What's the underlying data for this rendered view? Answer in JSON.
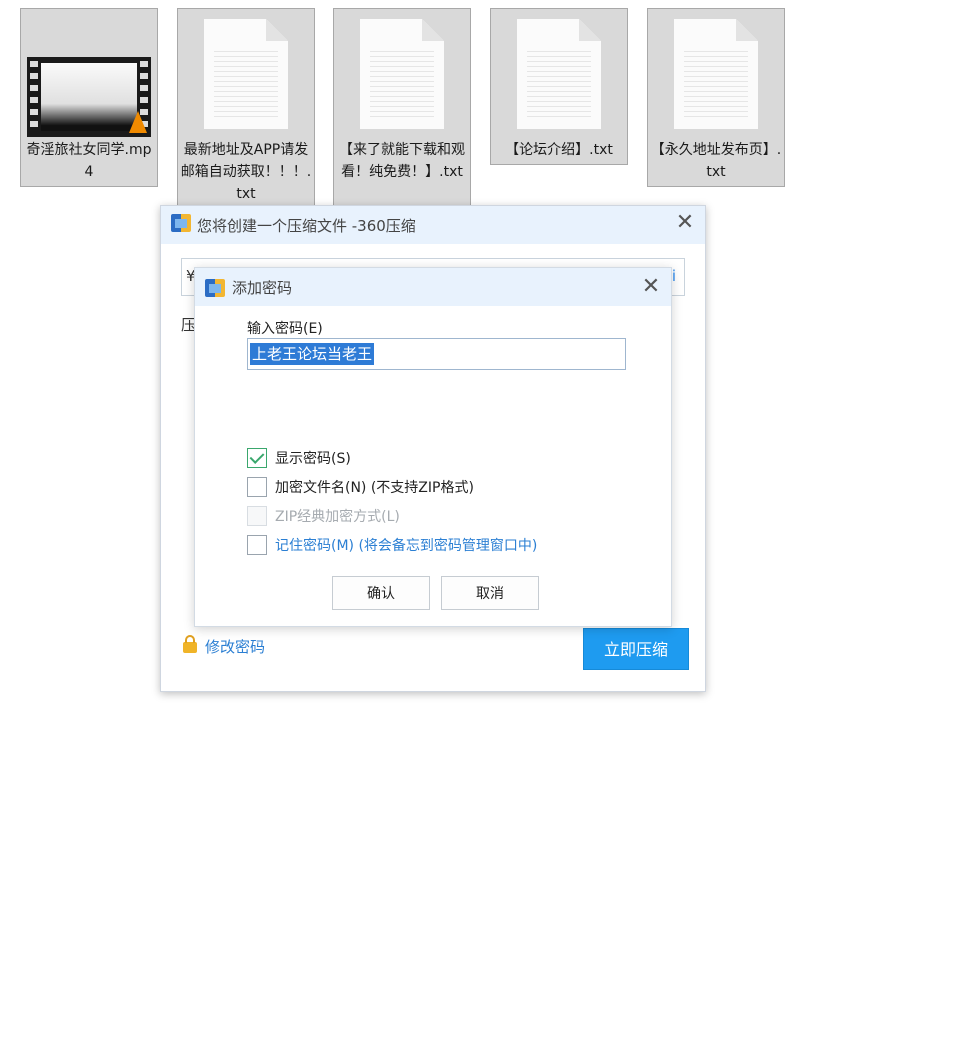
{
  "desktop": {
    "files": [
      {
        "name": "奇淫旅社女同学.mp4",
        "icon": "video-file-icon"
      },
      {
        "name": "最新地址及APP请发邮箱自动获取！！！.txt",
        "icon": "text-file-icon"
      },
      {
        "name": "【来了就能下载和观看！纯免费！】.txt",
        "icon": "text-file-icon"
      },
      {
        "name": "【论坛介绍】.txt",
        "icon": "text-file-icon"
      },
      {
        "name": "【永久地址发布页】.txt",
        "icon": "text-file-icon"
      }
    ]
  },
  "compress_dialog": {
    "title": "您将创建一个压缩文件 -360压缩",
    "field_fragment_left": "¥",
    "field_fragment_right": "i",
    "label_fragment": "压",
    "modify_password": "修改密码",
    "compress_now": "立即压缩"
  },
  "password_dialog": {
    "title": "添加密码",
    "password_label": "输入密码(E)",
    "password_value": "上老王论坛当老王",
    "show_password": {
      "label": "显示密码(S)",
      "checked": true
    },
    "encrypt_filename": {
      "label": "加密文件名(N) (不支持ZIP格式)",
      "checked": false
    },
    "zip_classic": {
      "label": "ZIP经典加密方式(L)",
      "checked": false,
      "disabled": true
    },
    "remember_password": {
      "label": "记住密码(M) (将会备忘到密码管理窗口中)",
      "checked": false
    },
    "ok": "确认",
    "cancel": "取消"
  },
  "colors": {
    "titlebar": "#e8f2fd",
    "primary_button": "#1e9bf0",
    "link": "#2b7fd3",
    "check": "#3aa76d"
  }
}
